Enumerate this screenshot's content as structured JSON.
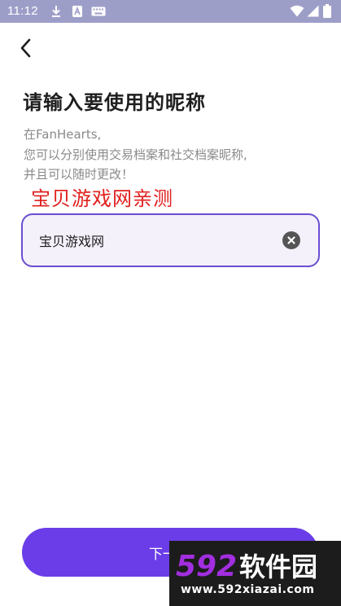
{
  "status_bar": {
    "time": "11:12",
    "icons": [
      "download-icon",
      "notification-a-icon",
      "keyboard-icon",
      "wifi-icon",
      "signal-icon",
      "battery-icon"
    ]
  },
  "header": {
    "back_icon": "chevron-left-icon"
  },
  "page": {
    "title": "请输入要使用的昵称",
    "description_lines": [
      "在FanHearts,",
      "您可以分别使用交易档案和社交档案昵称,",
      "并且可以随时更改！"
    ],
    "watermark_text": "宝贝游戏网亲测"
  },
  "nickname_field": {
    "value": "宝贝游戏网",
    "clear_icon": "clear-circle-icon"
  },
  "next_button": {
    "label": "下一步"
  },
  "logo": {
    "number": "592",
    "name": "软件园",
    "url": "www.592xiazai.com"
  },
  "colors": {
    "status_bar": "#9d9ec8",
    "accent": "#6a3de8",
    "field_border": "#6a4fd1",
    "field_bg": "#f4f1fb",
    "watermark": "#e0201e",
    "logo_number": "#a22ee0"
  }
}
